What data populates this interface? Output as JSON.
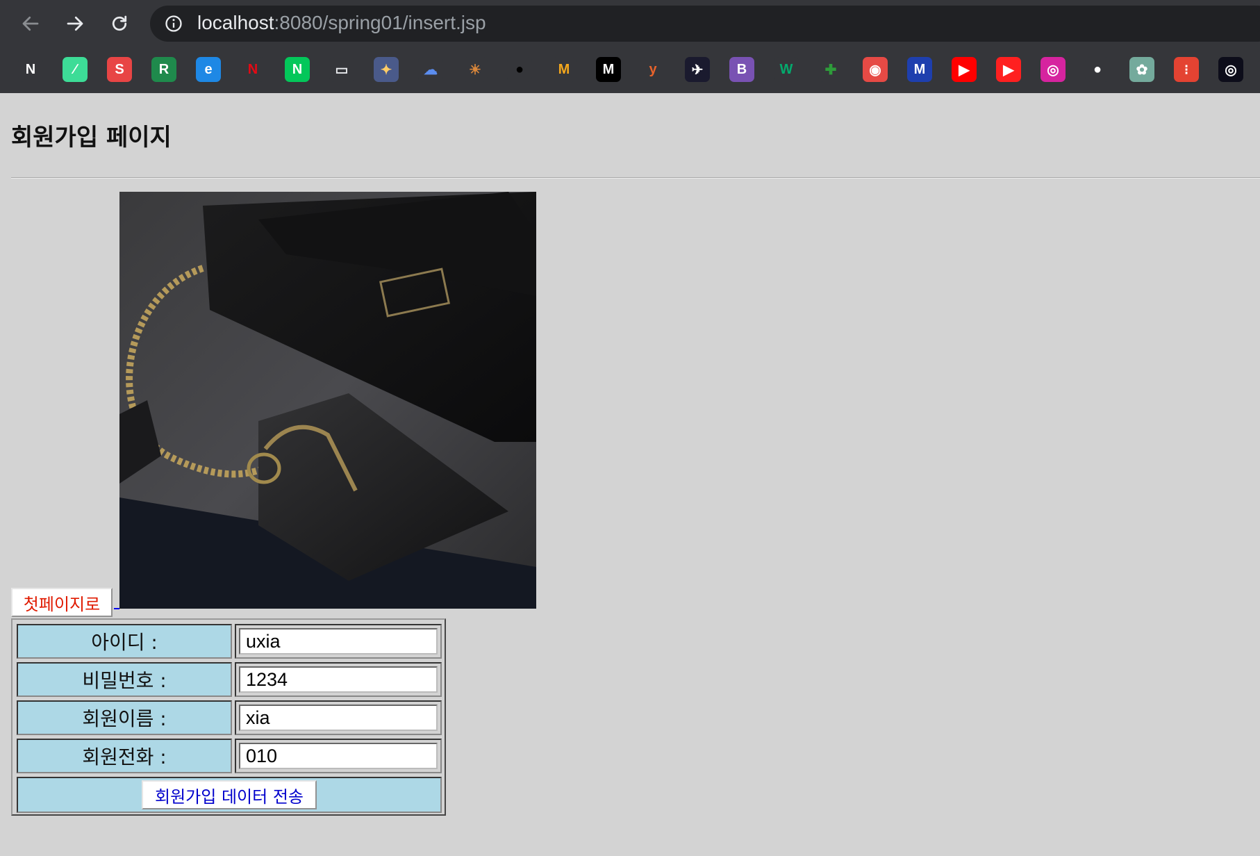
{
  "browser": {
    "url_host": "localhost",
    "url_path": ":8080/spring01/insert.jsp",
    "bookmarks": [
      {
        "name": "nip-icon",
        "glyph": "N",
        "bg": "#35363a",
        "fg": "#ffffff"
      },
      {
        "name": "mint-feather-icon",
        "glyph": "∕",
        "bg": "#3ddc97",
        "fg": "#ffffff"
      },
      {
        "name": "red-s-icon",
        "glyph": "S",
        "bg": "#e84545",
        "fg": "#ffffff"
      },
      {
        "name": "r-green-icon",
        "glyph": "R",
        "bg": "#1f8a4c",
        "fg": "#ffffff"
      },
      {
        "name": "edge-icon",
        "glyph": "e",
        "bg": "#1e88e5",
        "fg": "#ffffff"
      },
      {
        "name": "netflix-icon",
        "glyph": "N",
        "bg": "#35363a",
        "fg": "#e50914"
      },
      {
        "name": "naver-icon",
        "glyph": "N",
        "bg": "#03c75a",
        "fg": "#ffffff"
      },
      {
        "name": "chat-bubble-icon",
        "glyph": "▭",
        "bg": "#35363a",
        "fg": "#e8eaed"
      },
      {
        "name": "colorful-grid-icon",
        "glyph": "✦",
        "bg": "#4a5a8a",
        "fg": "#ffcc66"
      },
      {
        "name": "cloud-icon",
        "glyph": "☁",
        "bg": "#35363a",
        "fg": "#5b8def"
      },
      {
        "name": "sunrise-icon",
        "glyph": "☀",
        "bg": "#35363a",
        "fg": "#d9873b"
      },
      {
        "name": "black-circle-icon",
        "glyph": "●",
        "bg": "#35363a",
        "fg": "#000000"
      },
      {
        "name": "mcdonalds-icon",
        "glyph": "M",
        "bg": "#35363a",
        "fg": "#f4a81d"
      },
      {
        "name": "m-italic-icon",
        "glyph": "M",
        "bg": "#000000",
        "fg": "#ffffff"
      },
      {
        "name": "y-bracket-icon",
        "glyph": "y",
        "bg": "#35363a",
        "fg": "#e8632b"
      },
      {
        "name": "bird-icon",
        "glyph": "✈",
        "bg": "#1a1a2e",
        "fg": "#ffffff"
      },
      {
        "name": "bootstrap-icon",
        "glyph": "B",
        "bg": "#7952b3",
        "fg": "#ffffff"
      },
      {
        "name": "w3schools-icon",
        "glyph": "W",
        "bg": "#35363a",
        "fg": "#04aa6d"
      },
      {
        "name": "kangaroo-icon",
        "glyph": "✚",
        "bg": "#35363a",
        "fg": "#2e9c3a"
      },
      {
        "name": "red-badge-icon",
        "glyph": "◉",
        "bg": "#e64a45",
        "fg": "#ffffff"
      },
      {
        "name": "m-blue-icon",
        "glyph": "M",
        "bg": "#1e3fae",
        "fg": "#ffffff"
      },
      {
        "name": "youtube-icon",
        "glyph": "▶",
        "bg": "#ff0000",
        "fg": "#ffffff"
      },
      {
        "name": "youtube-music-icon",
        "glyph": "▶",
        "bg": "#ff2020",
        "fg": "#ffffff"
      },
      {
        "name": "instagram-icon",
        "glyph": "◎",
        "bg": "#d6249f",
        "fg": "#ffffff"
      },
      {
        "name": "github-icon",
        "glyph": "●",
        "bg": "#35363a",
        "fg": "#ffffff"
      },
      {
        "name": "chatgpt-icon",
        "glyph": "✿",
        "bg": "#74aa9c",
        "fg": "#ffffff"
      },
      {
        "name": "todoist-icon",
        "glyph": "⁝",
        "bg": "#e44332",
        "fg": "#ffffff"
      },
      {
        "name": "camera-lens-icon",
        "glyph": "◎",
        "bg": "#0d0d1a",
        "fg": "#ffffff"
      }
    ]
  },
  "page": {
    "title": "회원가입 페이지",
    "home_button": "첫페이지로",
    "form": {
      "rows": [
        {
          "label": "아이디 :",
          "value": "uxia"
        },
        {
          "label": "비밀번호 :",
          "value": "1234"
        },
        {
          "label": "회원이름 :",
          "value": "xia"
        },
        {
          "label": "회원전화 :",
          "value": "010"
        }
      ],
      "submit_label": "회원가입 데이터 전송"
    }
  }
}
